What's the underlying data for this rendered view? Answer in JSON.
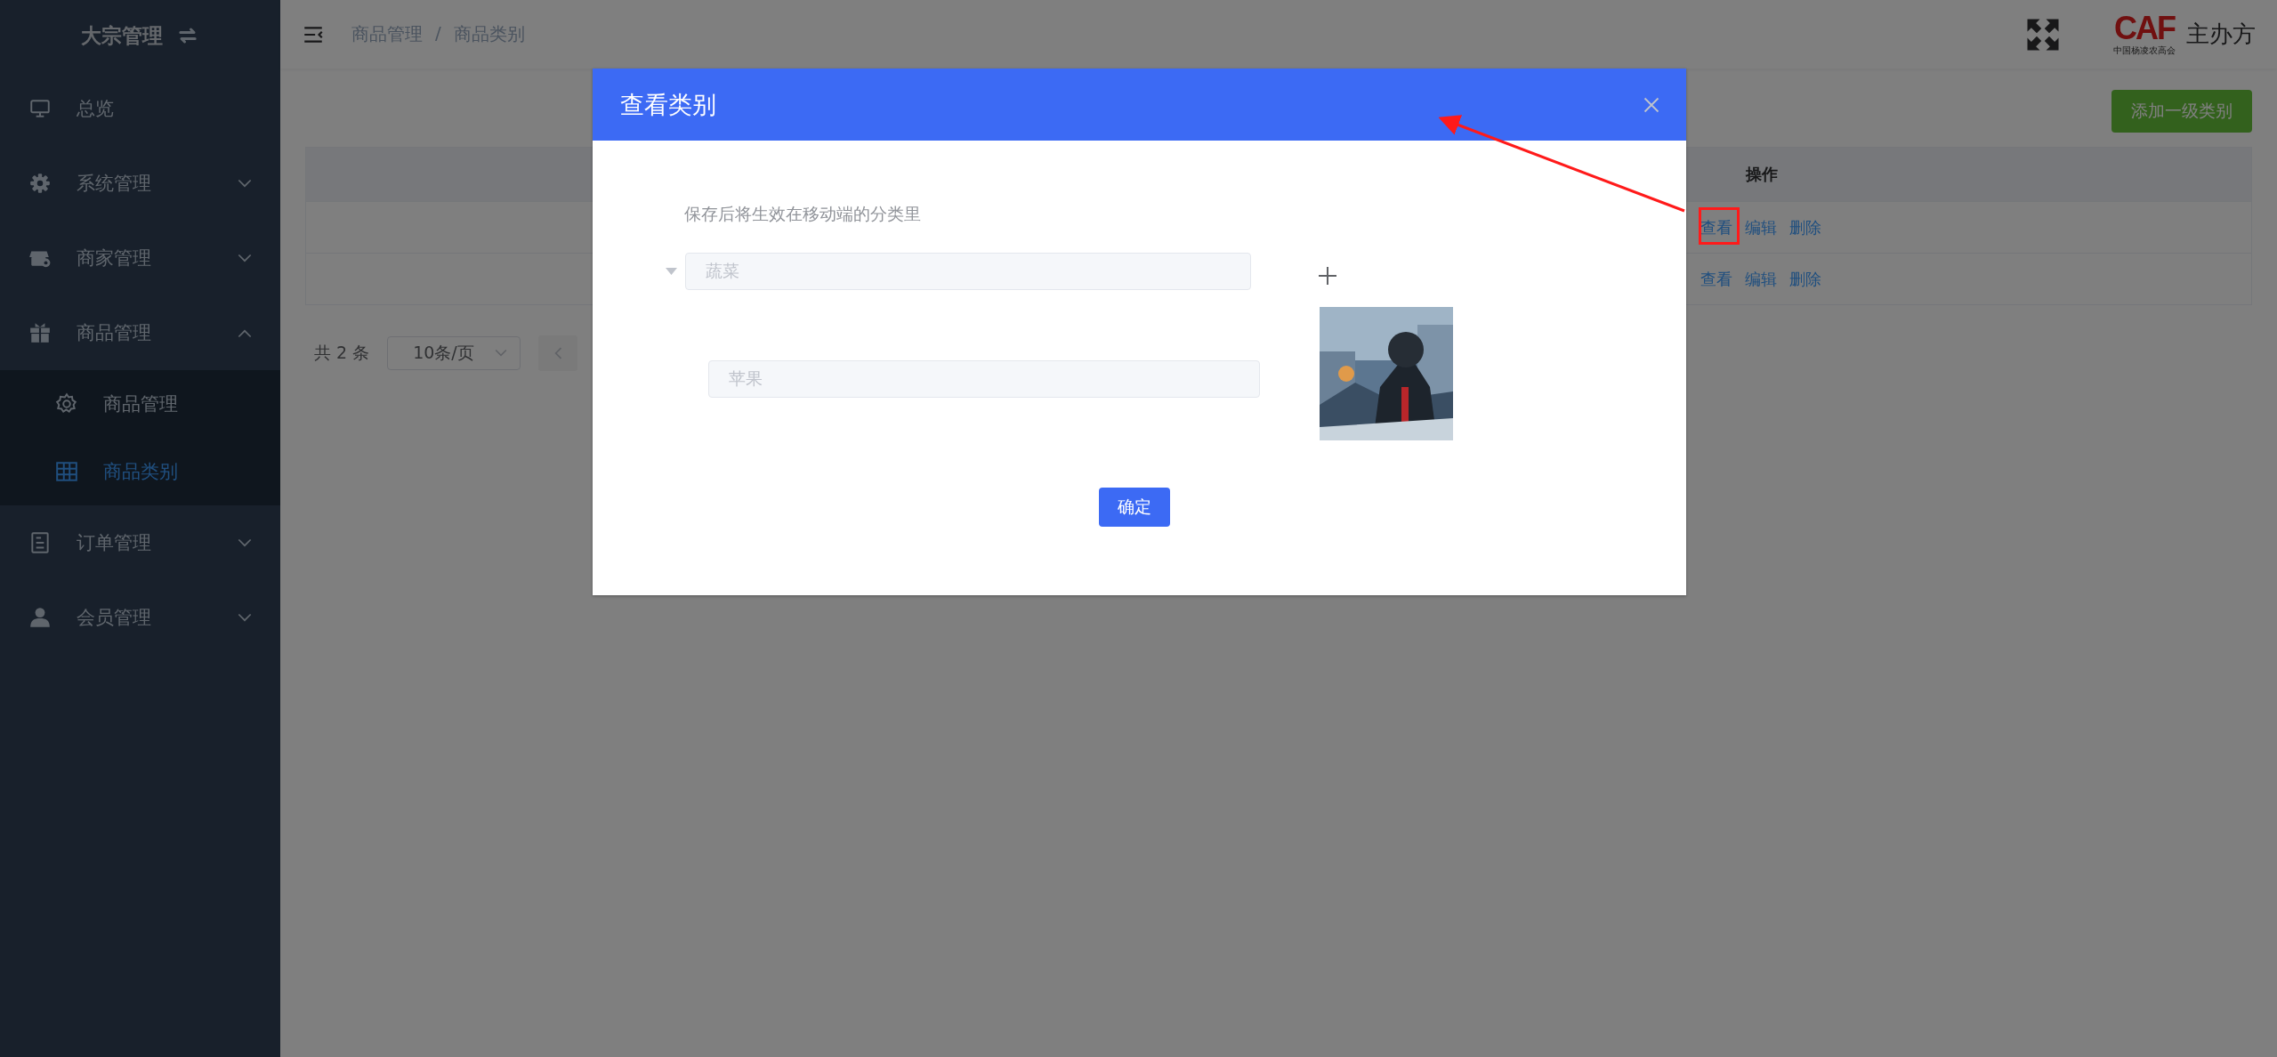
{
  "sidebar": {
    "title": "大宗管理",
    "items": [
      {
        "label": "总览"
      },
      {
        "label": "系统管理",
        "expanded": false
      },
      {
        "label": "商家管理",
        "expanded": false
      },
      {
        "label": "商品管理",
        "expanded": true,
        "children": [
          {
            "label": "商品管理",
            "selected": false
          },
          {
            "label": "商品类别",
            "selected": true
          }
        ]
      },
      {
        "label": "订单管理",
        "expanded": false
      },
      {
        "label": "会员管理",
        "expanded": false
      }
    ]
  },
  "header": {
    "breadcrumb": [
      "商品管理",
      "商品类别"
    ],
    "separator": "/",
    "logo": "CAF",
    "logo_subtitle": "中国杨凌农高会",
    "organizer": "主办方"
  },
  "page": {
    "add_button": "添加一级类别",
    "operation_column": "操作",
    "rows": [
      {
        "actions": [
          "查看",
          "编辑",
          "删除"
        ]
      },
      {
        "actions": [
          "查看",
          "编辑",
          "删除"
        ]
      }
    ],
    "pagination": {
      "total": "共 2 条",
      "page_size": "10条/页"
    }
  },
  "modal": {
    "title": "查看类别",
    "hint": "保存后将生效在移动端的分类里",
    "category_field": {
      "value": "蔬菜",
      "disabled": true
    },
    "subcategory_field": {
      "value": "苹果",
      "disabled": true
    },
    "confirm_button": "确定"
  }
}
